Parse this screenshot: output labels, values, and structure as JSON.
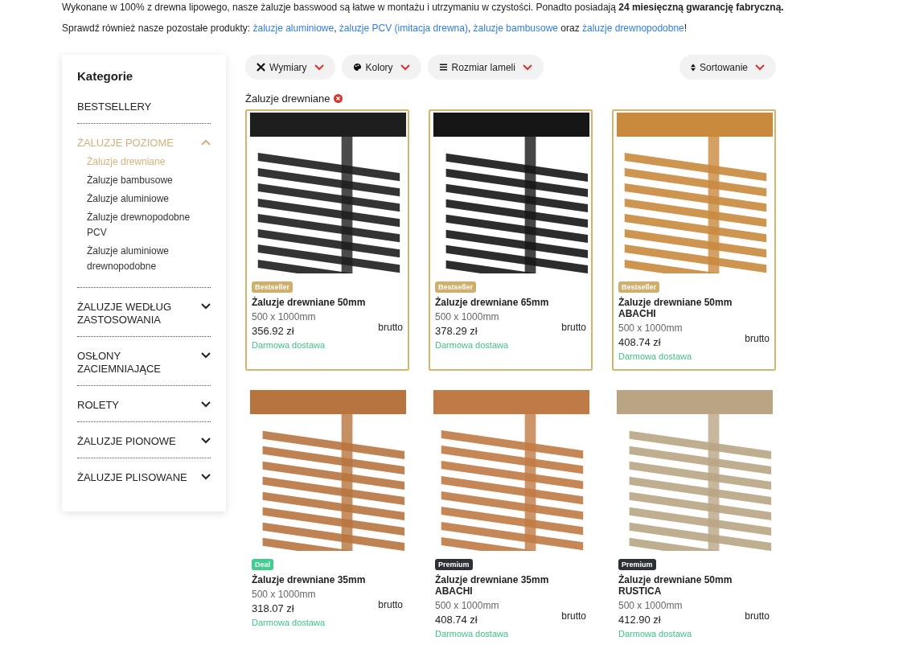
{
  "intro": {
    "text": "Wykonane w 100% z drewna lipowego, nasze żaluzje basswood są łatwe w montażu i utrzymaniu w czystości. Ponadto posiadają **24 miesięczną gwarancję fabryczną.**",
    "also_prefix": "Sprawdź również nasze pozostałe produkty: ",
    "also_links": [
      {
        "label": "żaluzje aluminiowe",
        "sep": ", "
      },
      {
        "label": "żaluzje PCV (imitacja drewna)",
        "sep": ", "
      },
      {
        "label": "żaluzje bambusowe",
        "sep": " oraz "
      },
      {
        "label": "żaluzje drewnopodobne",
        "sep": "!"
      }
    ]
  },
  "sidebar": {
    "title": "Kategorie",
    "items": [
      {
        "label": "BESTSELLERY",
        "kind": "link",
        "selected": false
      },
      {
        "label": "ŻALUZJE POZIOME",
        "kind": "group",
        "selected": true,
        "expanded": true,
        "children": [
          {
            "label": "Żaluzje drewniane",
            "selected": true
          },
          {
            "label": "Żaluzje bambusowe",
            "selected": false
          },
          {
            "label": "Żaluzje aluminiowe",
            "selected": false
          },
          {
            "label": "Żaluzje drewnopodobne PCV",
            "selected": false
          },
          {
            "label": "Żaluzje aluminiowe drewnopodobne",
            "selected": false
          }
        ]
      },
      {
        "label": "ŻALUZJE WEDŁUG ZASTOSOWANIA",
        "kind": "group",
        "selected": false,
        "expanded": false
      },
      {
        "label": "OSŁONY ZACIEMNIAJĄCE",
        "kind": "group",
        "selected": false,
        "expanded": false
      },
      {
        "label": "ROLETY",
        "kind": "group",
        "selected": false,
        "expanded": false
      },
      {
        "label": "ŻALUZJE PIONOWE",
        "kind": "group",
        "selected": false,
        "expanded": false
      },
      {
        "label": "ŻALUZJE PLISOWANE",
        "kind": "group",
        "selected": false,
        "expanded": false
      }
    ]
  },
  "filters": [
    {
      "label": "Wymiary"
    },
    {
      "label": "Kolory"
    },
    {
      "label": "Rozmiar lameli"
    }
  ],
  "sorting": {
    "label": "Sortowanie"
  },
  "active_filter": {
    "label": "Żaluzje drewniane"
  },
  "products": [
    {
      "badge": {
        "label": "Bestseller",
        "kind": "bestseller"
      },
      "name": "Żaluzje drewniane 50mm",
      "size": "500 x 1000mm",
      "price": "356.92 zł",
      "tax": "brutto",
      "shipping": "Darmowa dostawa",
      "highlighted": true,
      "color": "#1e1e1e"
    },
    {
      "badge": {
        "label": "Bestseller",
        "kind": "bestseller"
      },
      "name": "Żaluzje drewniane 65mm",
      "size": "500 x 1000mm",
      "price": "378.29 zł",
      "tax": "brutto",
      "shipping": "Darmowa dostawa",
      "highlighted": true,
      "color": "#161616"
    },
    {
      "badge": {
        "label": "Bestseller",
        "kind": "bestseller"
      },
      "name": "Żaluzje drewniane 50mm ABACHI",
      "size": "500 x 1000mm",
      "price": "408.74 zł",
      "tax": "brutto",
      "shipping": "Darmowa dostawa",
      "highlighted": true,
      "color": "#c98a3e"
    },
    {
      "badge": {
        "label": "Deal",
        "kind": "deal"
      },
      "name": "Żaluzje drewniane 35mm",
      "size": "500 x 1000mm",
      "price": "318.07 zł",
      "tax": "brutto",
      "shipping": "Darmowa dostawa",
      "highlighted": false,
      "color": "#b8743f"
    },
    {
      "badge": {
        "label": "Premium",
        "kind": "premium"
      },
      "name": "Żaluzje drewniane 35mm ABACHI",
      "size": "500 x 1000mm",
      "price": "408.74 zł",
      "tax": "brutto",
      "shipping": "Darmowa dostawa",
      "highlighted": false,
      "color": "#c07a45"
    },
    {
      "badge": {
        "label": "Premium",
        "kind": "premium"
      },
      "name": "Żaluzje drewniane 50mm RUSTICA",
      "size": "500 x 1000mm",
      "price": "412.90 zł",
      "tax": "brutto",
      "shipping": "Darmowa dostawa",
      "highlighted": false,
      "color": "#b9a584"
    }
  ]
}
